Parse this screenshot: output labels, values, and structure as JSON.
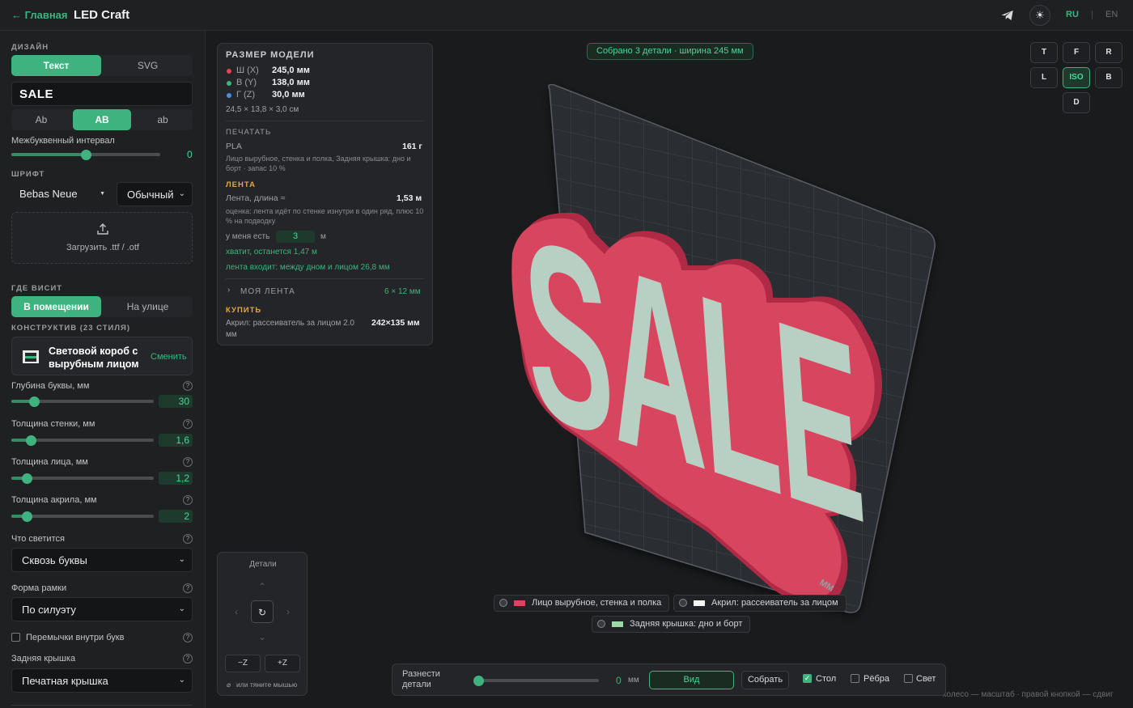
{
  "header": {
    "back_label": "← Главная",
    "title": "LED Craft",
    "lang_ru": "RU",
    "lang_sep": "|",
    "lang_en": "EN"
  },
  "sidebar": {
    "design_title": "ДИЗАЙН",
    "design_tabs": [
      "Текст",
      "SVG"
    ],
    "text_value": "SALE",
    "case_options": [
      "Ab",
      "AB",
      "ab"
    ],
    "spacing_label": "Межбуквенный интервал",
    "spacing_value": "0",
    "spacing_level": 0.5,
    "font_title": "ШРИФТ",
    "font_family": "Bebas Neue",
    "font_style": "Обычный",
    "upload_label": "Загрузить .ttf / .otf",
    "hang_title": "ГДЕ ВИСИТ",
    "hang_options": [
      "В помещении",
      "На улице"
    ],
    "construct_title": "КОНСТРУКТИВ (23 СТИЛЯ)",
    "construct_name": "Световой короб с вырубным лицом",
    "construct_change": "Сменить",
    "params": [
      {
        "label": "Глубина буквы, мм",
        "value": "30",
        "level": 0.16
      },
      {
        "label": "Толщина стенки, мм",
        "value": "1,6",
        "level": 0.14
      },
      {
        "label": "Толщина лица, мм",
        "value": "1,2",
        "level": 0.11
      },
      {
        "label": "Толщина акрила, мм",
        "value": "2",
        "level": 0.11
      }
    ],
    "glow_label": "Что светится",
    "glow_value": "Сквозь буквы",
    "frame_label": "Форма рамки",
    "frame_value": "По силуэту",
    "bridges_label": "Перемычки внутри букв",
    "back_label": "Задняя крышка",
    "back_value": "Печатная крышка",
    "help": "?"
  },
  "viewport": {
    "status": "Собрано 3 детали · ширина 245 мм",
    "view_buttons": [
      "T",
      "F",
      "R",
      "L",
      "ISO",
      "B",
      "D"
    ],
    "active_view": "ISO",
    "sign_text": "SALE",
    "plate_label": "ММ"
  },
  "info": {
    "title": "РАЗМЕР МОДЕЛИ",
    "dims": [
      {
        "axis": "Ш (X)",
        "value": "245,0 мм",
        "color": "#e0484f"
      },
      {
        "axis": "В (Y)",
        "value": "138,0 мм",
        "color": "#3fb37f"
      },
      {
        "axis": "Г (Z)",
        "value": "30,0 мм",
        "color": "#4a8de0"
      }
    ],
    "dims_cm": "24,5 × 13,8 × 3,0 см",
    "print_title": "ПЕЧАТАТЬ",
    "material": "PLA",
    "material_weight": "161 г",
    "material_note": "Лицо вырубное, стенка и полка, Задняя крышка: дно и борт · запас 10 %",
    "tape_title": "ЛЕНТА",
    "tape_len_label": "Лента, длина ≈",
    "tape_len_value": "1,53 м",
    "tape_note": "оценка: лента идёт по стенке изнутри в один ряд, плюс 10 % на подводку",
    "have_label": "у меня есть",
    "have_value": "3",
    "have_unit": "м",
    "enough": "хватит, останется 1,47 м",
    "fits": "лента входит: между дном и лицом 26,8 мм",
    "my_tape_label": "МОЯ ЛЕНТА",
    "my_tape_value": "6 × 12 мм",
    "buy_title": "КУПИТЬ",
    "buy_item": "Акрил: рассеиватель за лицом 2.0 мм",
    "buy_size": "242×135 мм"
  },
  "dpad": {
    "title": "Детали",
    "up": "⌃",
    "down": "⌄",
    "left": "‹",
    "right": "›",
    "reset": "↻",
    "minus_z": "−Z",
    "plus_z": "+Z",
    "mouse_hint": "или тяните мышью"
  },
  "legend": [
    {
      "label": "Лицо вырубное, стенка и полка",
      "color": "#d8455e"
    },
    {
      "label": "Акрил: рассеиватель за лицом",
      "color": "#f4f4f4"
    },
    {
      "label": "Задняя крышка: дно и борт",
      "color": "#9fd8a8"
    }
  ],
  "bottombar": {
    "spread_label": "Разнести детали",
    "spread_value": "0",
    "spread_unit": "мм",
    "view_btn": "Вид",
    "assemble_btn": "Собрать",
    "table_label": "Стол",
    "edges_label": "Рёбра",
    "light_label": "Свет"
  },
  "hint": "колесо — масштаб · правой кнопкой — сдвиг"
}
